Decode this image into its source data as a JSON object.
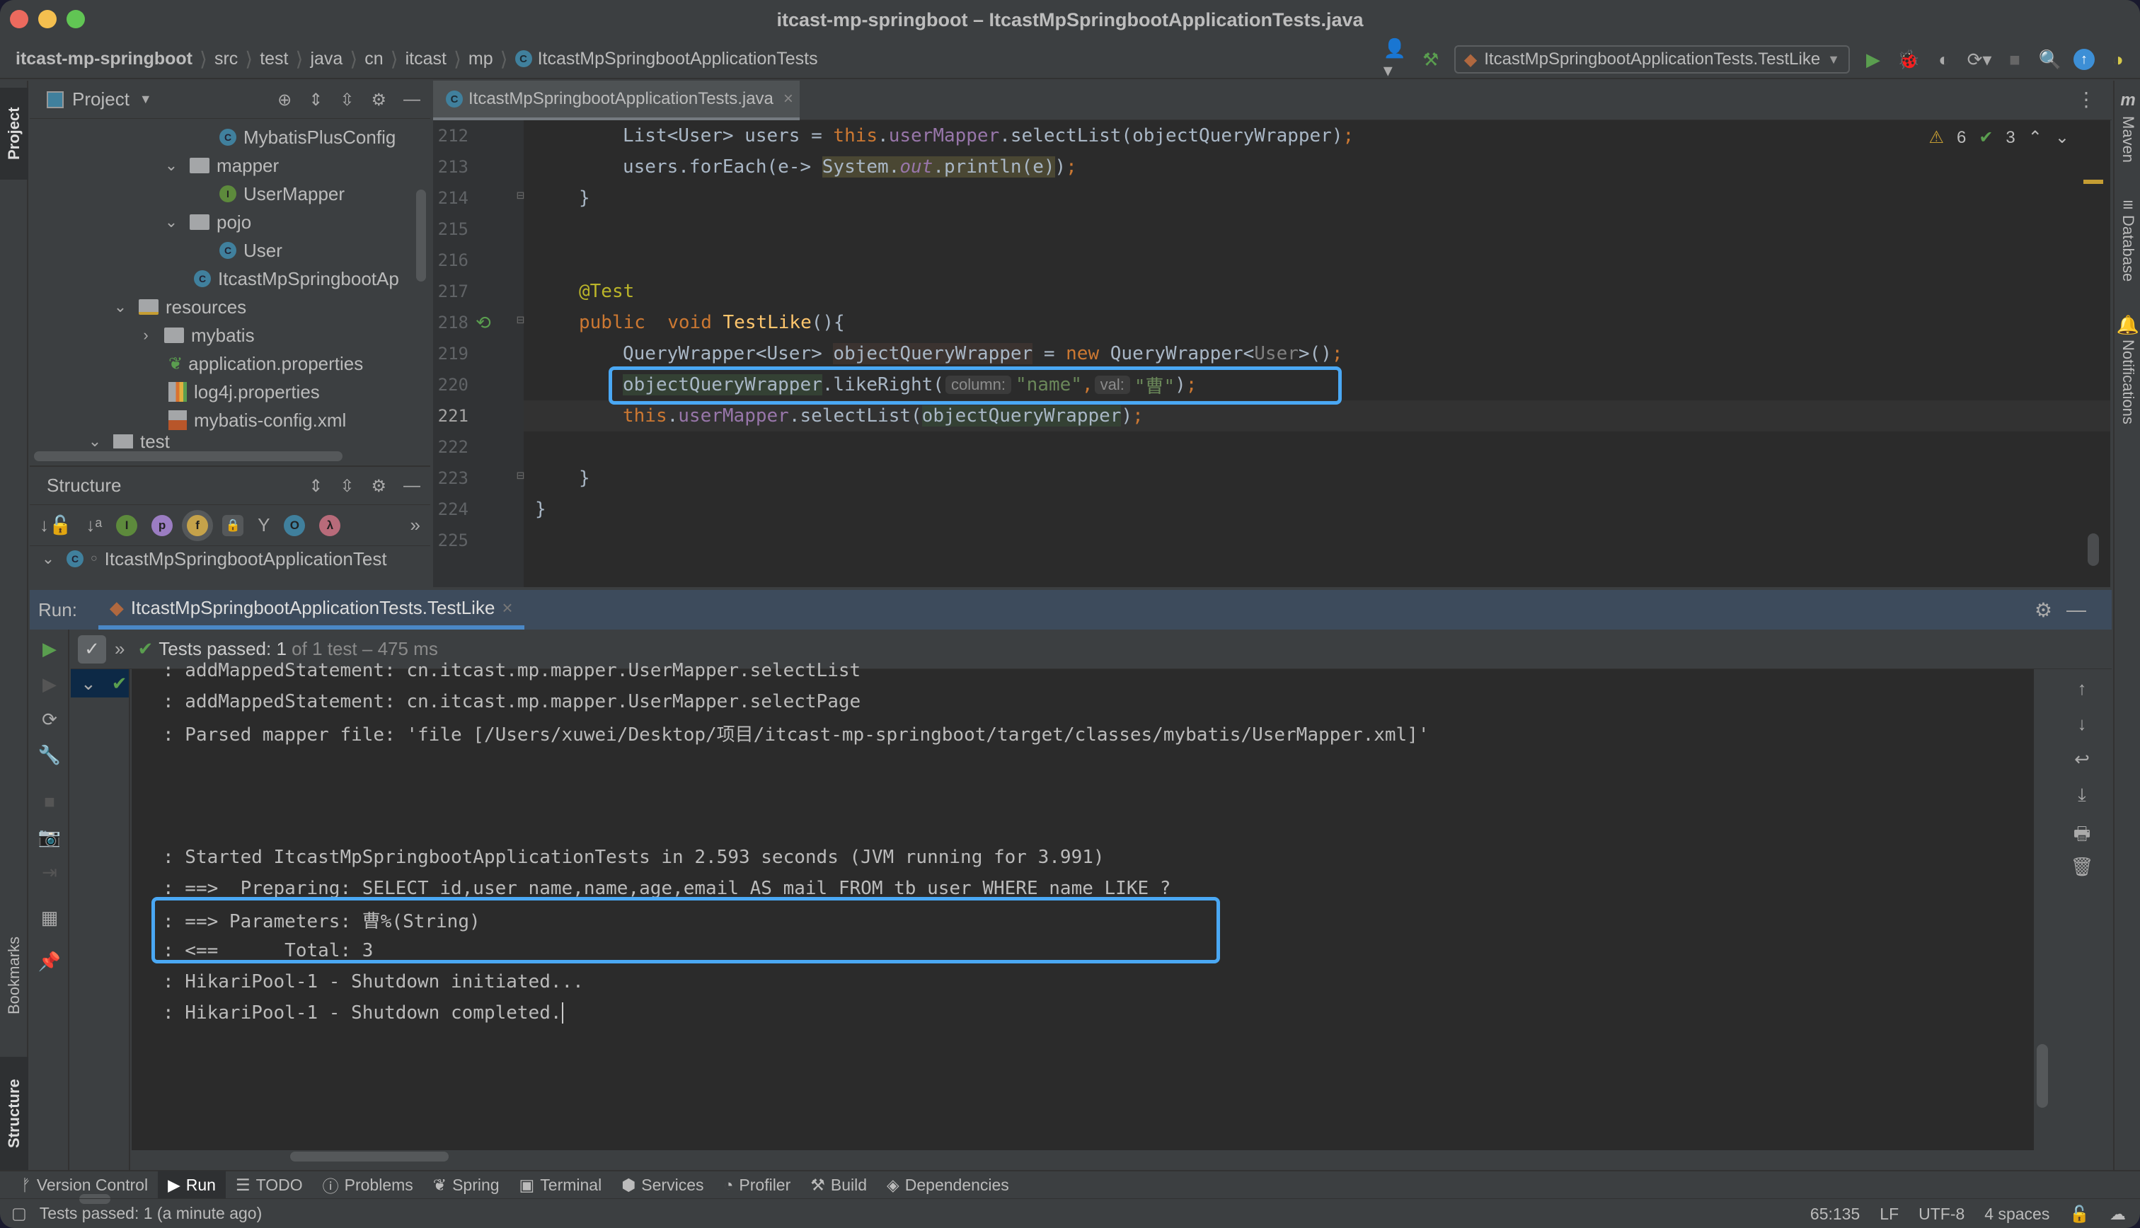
{
  "window": {
    "title": "itcast-mp-springboot – ItcastMpSpringbootApplicationTests.java"
  },
  "breadcrumbs": [
    "itcast-mp-springboot",
    "src",
    "test",
    "java",
    "cn",
    "itcast",
    "mp",
    "ItcastMpSpringbootApplicationTests"
  ],
  "toolbar": {
    "run_config": "ItcastMpSpringbootApplicationTests.TestLike",
    "icons": [
      "user-icon",
      "build-hammer-icon",
      "run-icon",
      "debug-icon",
      "coverage-icon",
      "profile-icon",
      "stop-icon",
      "search-icon",
      "update-icon",
      "jetbrains-icon"
    ]
  },
  "left_strip": {
    "project_tab": "Project",
    "bookmarks_tab": "Bookmarks",
    "structure_tab": "Structure"
  },
  "project_panel": {
    "title": "Project",
    "tree": [
      {
        "label": "MybatisPlusConfig",
        "type": "class"
      },
      {
        "label": "mapper",
        "type": "package",
        "expanded": true
      },
      {
        "label": "UserMapper",
        "type": "interface"
      },
      {
        "label": "pojo",
        "type": "package",
        "expanded": true
      },
      {
        "label": "User",
        "type": "class"
      },
      {
        "label": "ItcastMpSpringbootAp",
        "type": "spring-app"
      },
      {
        "label": "resources",
        "type": "resources-folder",
        "expanded": true
      },
      {
        "label": "mybatis",
        "type": "folder",
        "expanded": false
      },
      {
        "label": "application.properties",
        "type": "spring-properties"
      },
      {
        "label": "log4j.properties",
        "type": "properties"
      },
      {
        "label": "mybatis-config.xml",
        "type": "xml"
      },
      {
        "label": "test",
        "type": "folder",
        "expanded": true
      }
    ]
  },
  "structure_panel": {
    "title": "Structure",
    "root": "ItcastMpSpringbootApplicationTest"
  },
  "editor": {
    "tab_label": "ItcastMpSpringbootApplicationTests.java",
    "warnings": "6",
    "weak_warnings": "3",
    "current_line": "221",
    "lines": [
      {
        "n": "212"
      },
      {
        "n": "213"
      },
      {
        "n": "214"
      },
      {
        "n": "215"
      },
      {
        "n": "216"
      },
      {
        "n": "217"
      },
      {
        "n": "218"
      },
      {
        "n": "219"
      },
      {
        "n": "220"
      },
      {
        "n": "221"
      },
      {
        "n": "222"
      },
      {
        "n": "223"
      },
      {
        "n": "224"
      },
      {
        "n": "225"
      }
    ],
    "code": {
      "l212": {
        "a": "List<User> users = ",
        "b": "this",
        "c": ".",
        "d": "userMapper",
        "e": ".selectList(objectQueryWrapper)",
        "f": ";"
      },
      "l213": {
        "a": "users.forEach(e-> ",
        "b": "System.",
        "c": "out",
        "d": ".println(e)",
        "e": ")",
        "f": ";"
      },
      "l214": "}",
      "l217": "@Test",
      "l218": {
        "a": "public",
        "b": "  ",
        "c": "void",
        "d": " ",
        "e": "TestLike",
        "f": "(){"
      },
      "l219": {
        "a": "QueryWrapper<User> ",
        "b": "objectQueryWrapper",
        "c": " = ",
        "d": "new",
        "e": " QueryWrapper<",
        "f": "User",
        "g": ">()",
        "h": ";"
      },
      "l220": {
        "a": "objectQueryWrapper",
        "b": ".likeRight(",
        "hint1": "column:",
        "c": "\"name\"",
        "d": ",",
        "hint2": "val:",
        "e": "\"曹\"",
        "f": ")",
        "g": ";"
      },
      "l221": {
        "a": "this",
        "b": ".",
        "c": "userMapper",
        "d": ".selectList(",
        "e": "objectQueryWrapper",
        "f": ")",
        "g": ";"
      },
      "l223": "}",
      "l224": "}"
    }
  },
  "run_panel": {
    "label": "Run:",
    "tab": "ItcastMpSpringbootApplicationTests.TestLike",
    "status_prefix": "Tests passed: ",
    "status_count": "1",
    "status_suffix": " of 1 test – 475 ms",
    "console": [
      ": addMappedStatement: cn.itcast.mp.mapper.UserMapper.selectList",
      ": addMappedStatement: cn.itcast.mp.mapper.UserMapper.selectPage",
      ": Parsed mapper file: 'file [/Users/xuwei/Desktop/项目/itcast-mp-springboot/target/classes/mybatis/UserMapper.xml]'",
      "",
      "",
      "",
      ": Started ItcastMpSpringbootApplicationTests in 2.593 seconds (JVM running for 3.991)",
      ": ==>  Preparing: SELECT id,user_name,name,age,email AS mail FROM tb_user WHERE name LIKE ?",
      ": ==> Parameters: 曹%(String)",
      ": <==      Total: 3",
      ": HikariPool-1 - Shutdown initiated...",
      ": HikariPool-1 - Shutdown completed."
    ]
  },
  "right_strip": {
    "tabs": [
      "Maven",
      "Database",
      "Notifications"
    ]
  },
  "bottom_tabs": [
    {
      "label": "Version Control",
      "icon": "branch-icon"
    },
    {
      "label": "Run",
      "icon": "run-icon",
      "active": true
    },
    {
      "label": "TODO",
      "icon": "list-icon"
    },
    {
      "label": "Problems",
      "icon": "problems-icon"
    },
    {
      "label": "Spring",
      "icon": "spring-icon"
    },
    {
      "label": "Terminal",
      "icon": "terminal-icon"
    },
    {
      "label": "Services",
      "icon": "services-icon"
    },
    {
      "label": "Profiler",
      "icon": "profiler-icon"
    },
    {
      "label": "Build",
      "icon": "build-icon"
    },
    {
      "label": "Dependencies",
      "icon": "dependencies-icon"
    }
  ],
  "status_bar": {
    "message": "Tests passed: 1 (a minute ago)",
    "position": "65:135",
    "line_ending": "LF",
    "encoding": "UTF-8",
    "indent": "4 spaces"
  },
  "colors": {
    "accent_blue": "#4aa8f4",
    "success_green": "#5a9e4f",
    "warning_yellow": "#c59d33"
  }
}
